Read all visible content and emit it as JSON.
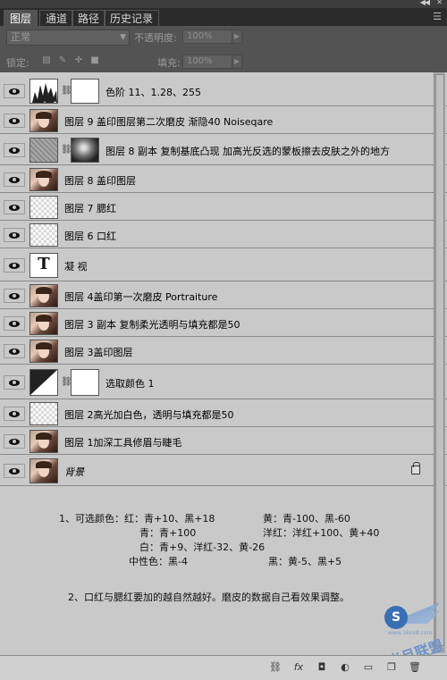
{
  "tabs": [
    {
      "label": "图层",
      "active": true
    },
    {
      "label": "通道",
      "active": false
    },
    {
      "label": "路径",
      "active": false
    },
    {
      "label": "历史记录",
      "active": false
    }
  ],
  "options": {
    "blend_mode": "正常",
    "opacity_label": "不透明度:",
    "opacity_value": "100%",
    "lock_label": "锁定:",
    "fill_label": "填充:",
    "fill_value": "100%"
  },
  "layers": [
    {
      "name": "色阶  11、1.28、255",
      "thumb": "levels",
      "mask": "white",
      "linked": true
    },
    {
      "name": "图层 9 盖印图层第二次磨皮 渐隐40 Noiseqare",
      "thumb": "photo"
    },
    {
      "name": "图层 8 副本  复制基底凸现   加高光反选的蒙板擦去皮肤之外的地方",
      "thumb": "gray",
      "mask": "bw",
      "linked": true
    },
    {
      "name": "图层 8 盖印图层",
      "thumb": "photo"
    },
    {
      "name": "图层 7 腮红",
      "thumb": "checker"
    },
    {
      "name": "图层 6 口红",
      "thumb": "checker"
    },
    {
      "name": "凝 视",
      "thumb": "text",
      "thumb_text": "T"
    },
    {
      "name": "图层 4盖印第一次磨皮 Portraiture",
      "thumb": "photo"
    },
    {
      "name": "图层 3 副本  复制柔光透明与填充都是50",
      "thumb": "photo"
    },
    {
      "name": "图层 3盖印图层",
      "thumb": "photo"
    },
    {
      "name": "选取颜色 1",
      "thumb": "selcol",
      "mask": "white",
      "linked": true
    },
    {
      "name": "图层 2高光加白色，透明与填充都是50",
      "thumb": "checker"
    },
    {
      "name": "图层 1加深工具修眉与睫毛",
      "thumb": "photo"
    },
    {
      "name": "背景",
      "thumb": "photo",
      "italic": true,
      "locked": true
    }
  ],
  "notes": {
    "line1a": "1、可选颜色：红：青+10、黑+18",
    "line1b": "黄：青-100、黑-60",
    "line2a": "青：青+100",
    "line2b": "洋红：洋红+100、黄+40",
    "line3": "白：青+9、洋红-32、黄-26",
    "line4a": "中性色：黑-4",
    "line4b": "黑：黄-5、黑+5",
    "line5": "2、口红与腮红要加的越自然越好。磨皮的数据自己看效果调整。"
  },
  "watermark": {
    "logo_letter": "S",
    "text": "当月联盟",
    "url": "www.16xx8.com"
  },
  "colors": {
    "panel_bg": "#c9c9c9",
    "header_bg": "#535353",
    "tab_bar": "#2b2b2b",
    "watermark_blue": "#3a6fb4"
  }
}
